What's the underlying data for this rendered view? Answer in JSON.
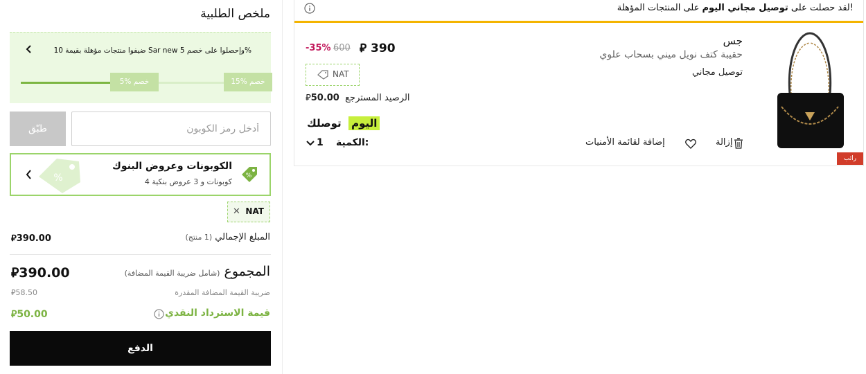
{
  "summary": {
    "title": "ملخص الطلبية",
    "promo": {
      "text": "ضيفوا منتجات مؤهلة بقيمة 10 Sar new وإحصلوا على خصم 5%",
      "tier_high": "15% خصم",
      "tier_low": "5% خصم",
      "progress": 0.4
    },
    "coupon": {
      "placeholder": "أدخل رمز الكوبون",
      "apply_label": "طبّق"
    },
    "offers": {
      "title": "الكوبونات وعروض البنوك",
      "subtitle": "4 كوبونات  و  3 عروض بنكية"
    },
    "applied_coupon": "NAT",
    "subtotal": {
      "label": "المبلغ الإجمالي",
      "count": "(1 منتج)",
      "value": "390.00"
    },
    "total": {
      "label": "المجموع",
      "note": "(شامل ضريبة القيمة المضافة)",
      "value": "390.00"
    },
    "vat": {
      "label": "ضريبة القيمة المضافة المقدرة",
      "value": "58.50"
    },
    "cashback": {
      "label": "قيمة الاسترداد النقدي",
      "value": "50.00"
    },
    "pay_label": "الدفع"
  },
  "cart": {
    "notice": {
      "pre": "لقد حصلت على ",
      "bold": "توصيل مجاني اليوم",
      "post": " على المنتجات المؤهلة!"
    },
    "item": {
      "brand": "جس",
      "name": "حقيبة كتف نويل ميني بسحاب علوي",
      "shipping": "توصيل مجاني",
      "price": "390",
      "old_price": "600",
      "discount": "-35%",
      "coupon_tag": "NAT",
      "cashback_label": "الرصيد المسترجع",
      "cashback_value": "50.00",
      "delivery_label": "توصلك",
      "delivery_day": "اليوم",
      "qty_label": "الكمية:",
      "qty_value": "1",
      "wishlist_label": "إضافة لقائمة الأمنيات",
      "remove_label": "إزالة",
      "seller_badge": "رائب"
    }
  },
  "colors": {
    "accent_green": "#7cb342",
    "notice_bar": "#f4b400",
    "discount": "#c2185b",
    "today_highlight": "#c7ef3c"
  },
  "icons": [
    "chevron-left-icon",
    "coupon-tag-icon",
    "info-icon",
    "tag-icon",
    "heart-icon",
    "trash-icon",
    "chevron-down-icon",
    "riyal-icon"
  ]
}
